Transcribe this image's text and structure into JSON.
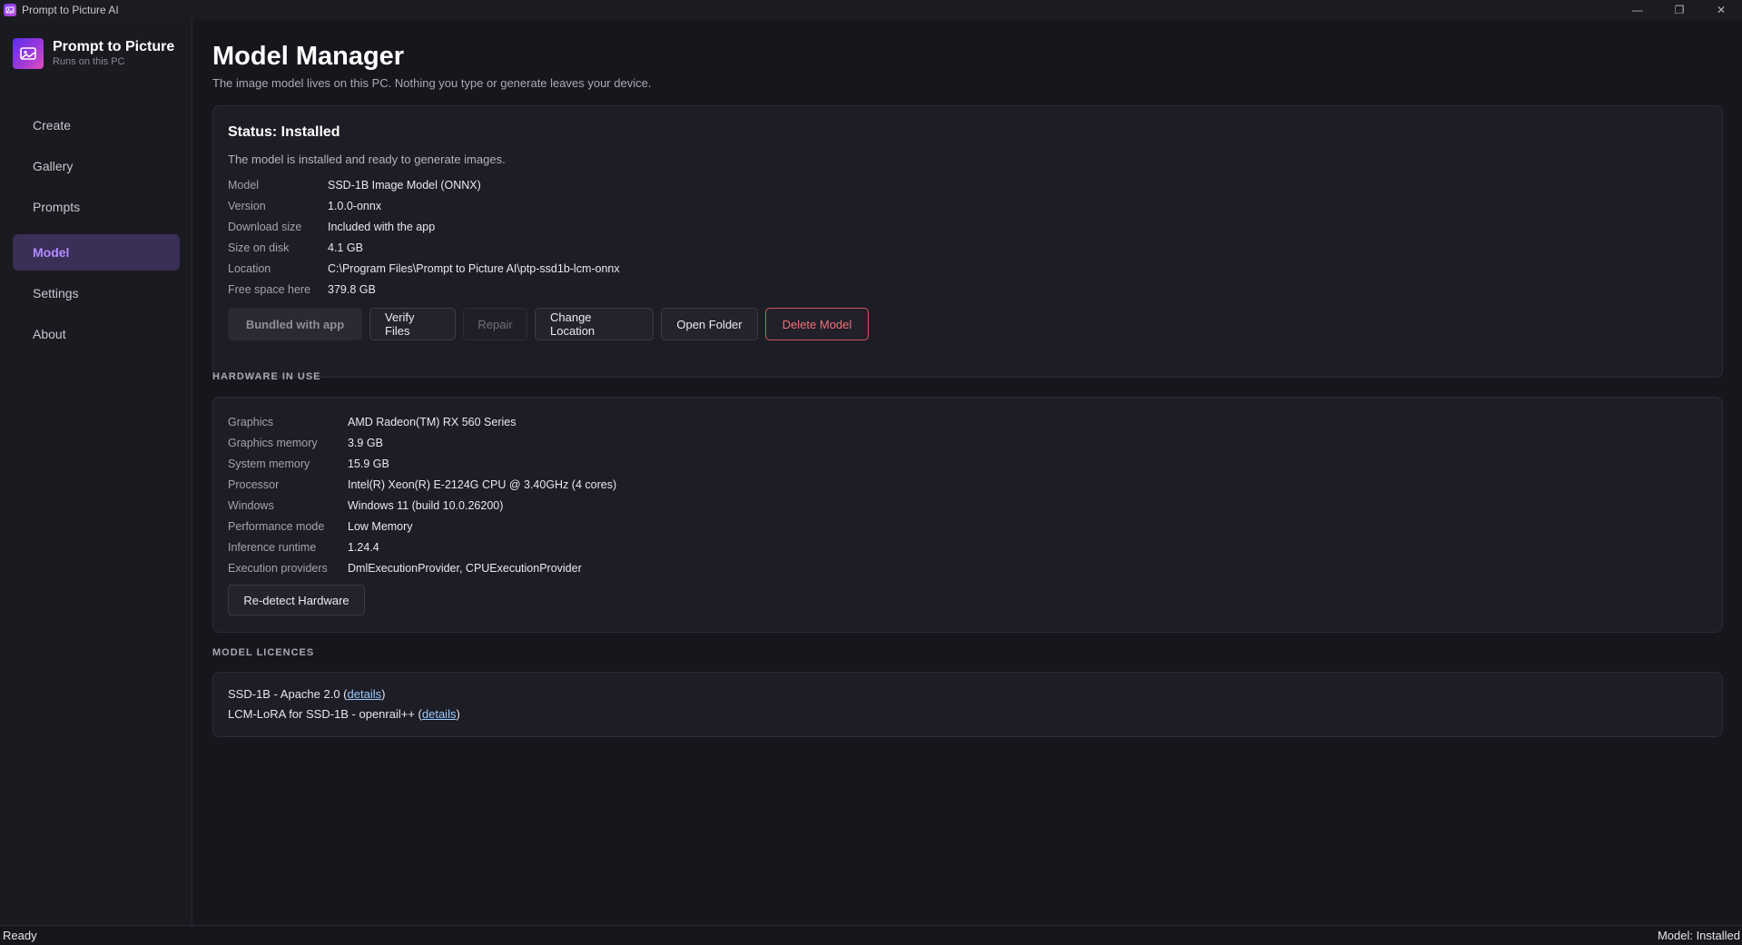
{
  "window": {
    "title": "Prompt to Picture AI",
    "controls": {
      "minimize": "—",
      "maximize": "❐",
      "close": "✕"
    }
  },
  "brand": {
    "name": "Prompt to Picture",
    "subtitle": "Runs on this PC"
  },
  "nav": {
    "items": [
      {
        "label": "Create"
      },
      {
        "label": "Gallery"
      },
      {
        "label": "Prompts"
      },
      {
        "label": "Model",
        "active": true
      },
      {
        "label": "Settings"
      },
      {
        "label": "About"
      }
    ]
  },
  "page": {
    "title": "Model Manager",
    "subtitle": "The image model lives on this PC. Nothing you type or generate leaves your device."
  },
  "status": {
    "title": "Status: Installed",
    "description": "The model is installed and ready to generate images.",
    "fields": [
      {
        "key": "Model",
        "value": "SSD-1B Image Model (ONNX)"
      },
      {
        "key": "Version",
        "value": "1.0.0-onnx"
      },
      {
        "key": "Download size",
        "value": "Included with the app"
      },
      {
        "key": "Size on disk",
        "value": "4.1 GB"
      },
      {
        "key": "Location",
        "value": "C:\\Program Files\\Prompt to Picture AI\\ptp-ssd1b-lcm-onnx"
      },
      {
        "key": "Free space here",
        "value": "379.8 GB"
      }
    ],
    "buttons": {
      "bundled": "Bundled with app",
      "verify": "Verify Files",
      "repair": "Repair",
      "change_location": "Change Location",
      "open_folder": "Open Folder",
      "delete": "Delete Model"
    }
  },
  "hardware": {
    "heading": "HARDWARE IN USE",
    "fields": [
      {
        "key": "Graphics",
        "value": "AMD Radeon(TM) RX 560 Series"
      },
      {
        "key": "Graphics memory",
        "value": "3.9 GB"
      },
      {
        "key": "System memory",
        "value": "15.9 GB"
      },
      {
        "key": "Processor",
        "value": "Intel(R) Xeon(R) E-2124G CPU @ 3.40GHz (4 cores)"
      },
      {
        "key": "Windows",
        "value": "Windows 11 (build 10.0.26200)"
      },
      {
        "key": "Performance mode",
        "value": "Low Memory"
      },
      {
        "key": "Inference runtime",
        "value": "1.24.4"
      },
      {
        "key": "Execution providers",
        "value": "DmlExecutionProvider, CPUExecutionProvider"
      }
    ],
    "redetect_button": "Re-detect Hardware"
  },
  "licences": {
    "heading": "MODEL LICENCES",
    "items": [
      {
        "text": "SSD-1B - Apache 2.0 (",
        "link": "details",
        "suffix": ")"
      },
      {
        "text": "LCM-LoRA for SSD-1B - openrail++ (",
        "link": "details",
        "suffix": ")"
      }
    ]
  },
  "statusbar": {
    "left": "Ready",
    "right": "Model: Installed"
  },
  "colors": {
    "accent": "#b48cff",
    "danger": "#f07178",
    "link": "#9ecbff",
    "background": "#16161d"
  }
}
